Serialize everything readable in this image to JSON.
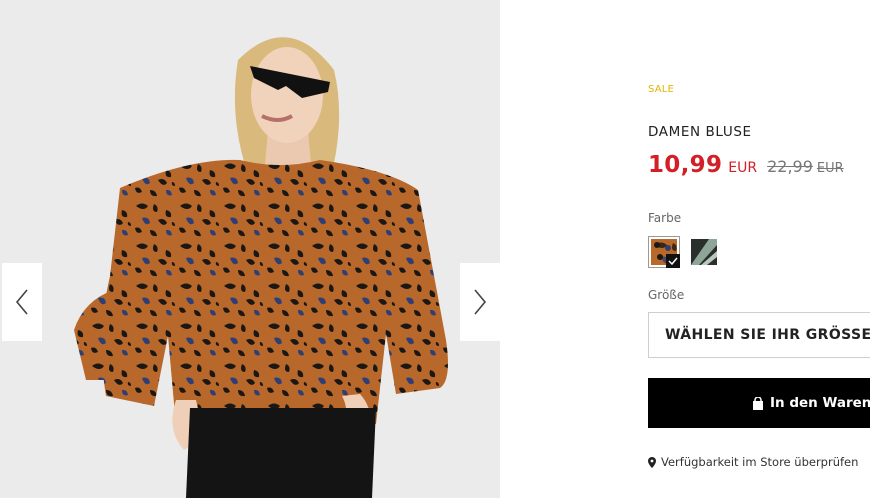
{
  "gallery": {
    "prev_icon": "chevron-left-icon",
    "next_icon": "chevron-right-icon"
  },
  "product": {
    "badge": "SALE",
    "title": "DAMEN BLUSE",
    "price_current": "10,99",
    "price_current_unit": "EUR",
    "price_old": "22,99",
    "price_old_unit": "EUR",
    "color_label": "Farbe",
    "colors": [
      {
        "name": "leopard",
        "selected": true
      },
      {
        "name": "green-pattern",
        "selected": false
      }
    ],
    "size_label": "Größe",
    "size_placeholder": "WÄHLEN SIE IHR GRÖSSE",
    "cart_button": "In den Waren",
    "store_link": "Verfügbarkeit im Store überprüfen"
  },
  "colors": {
    "sale": "#e2b400",
    "price": "#d31f26",
    "button_bg": "#000000"
  }
}
